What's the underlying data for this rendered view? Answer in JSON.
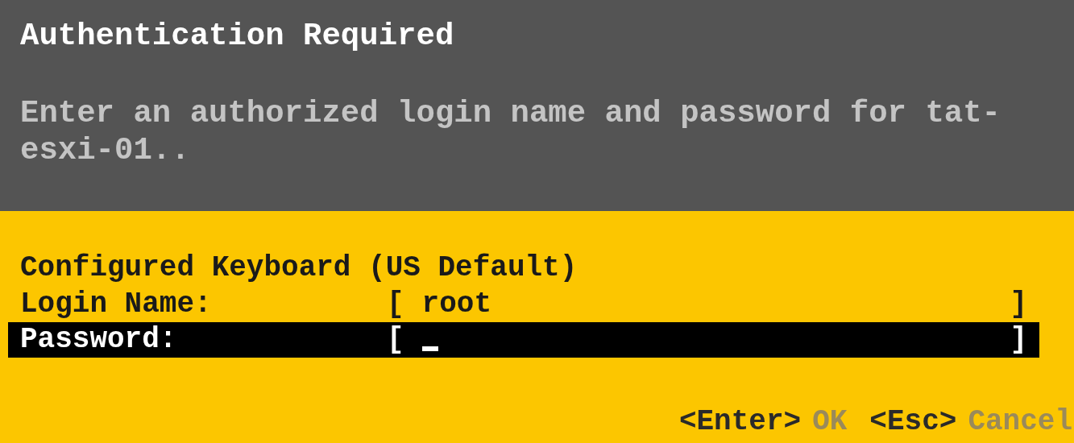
{
  "dialog": {
    "title": "Authentication Required",
    "message": "Enter an authorized login name and password for tat-esxi-01.."
  },
  "keyboard_label": "Configured Keyboard (US Default)",
  "fields": [
    {
      "label": "Login Name:",
      "open": "[",
      "value": "root",
      "close": "]",
      "selected": false
    },
    {
      "label": "Password:",
      "open": "[",
      "close": "]",
      "selected": true
    }
  ],
  "actions": [
    {
      "key": "<Enter>",
      "label": "OK"
    },
    {
      "key": "<Esc>",
      "label": "Cancel"
    }
  ]
}
